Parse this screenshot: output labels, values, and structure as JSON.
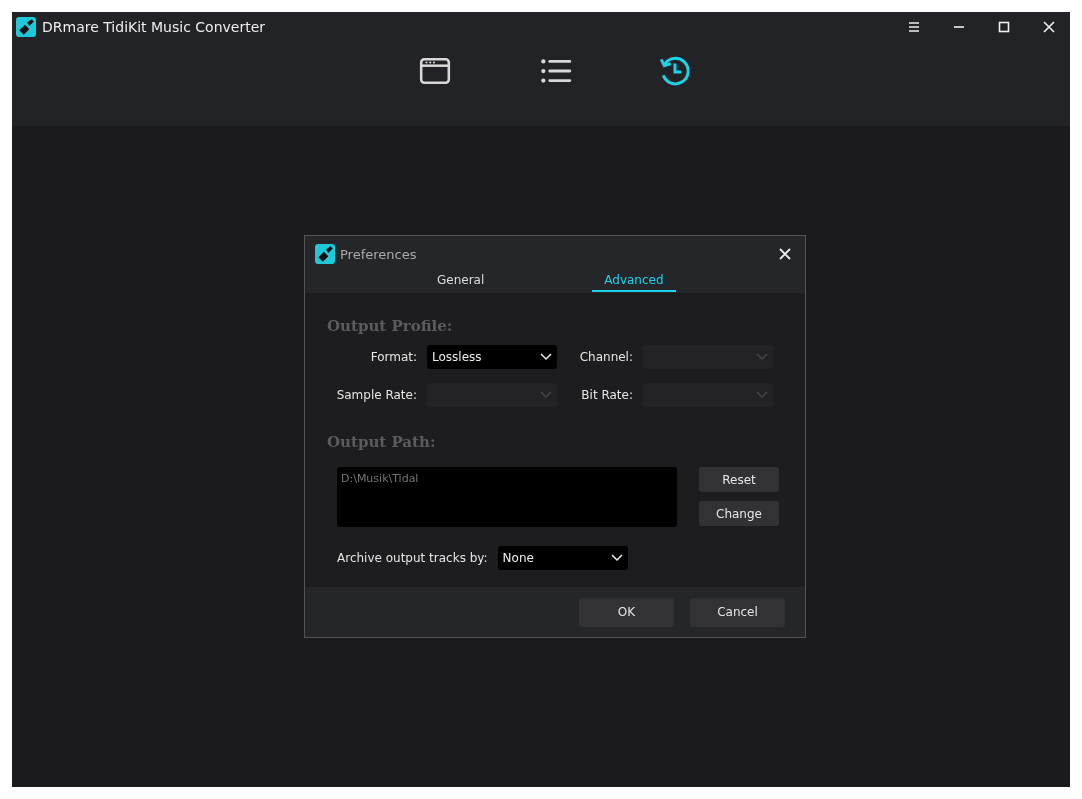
{
  "window": {
    "title": "DRmare TidiKit Music Converter"
  },
  "toolbar": [
    {
      "kind": "browser",
      "selected": false
    },
    {
      "kind": "list",
      "selected": false
    },
    {
      "kind": "history",
      "selected": true
    }
  ],
  "dialog": {
    "title": "Preferences",
    "tabs": [
      {
        "label": "General",
        "selected": false
      },
      {
        "label": "Advanced",
        "selected": true
      }
    ],
    "output_profile": {
      "heading": "Output Profile:",
      "fields": [
        {
          "label": "Format:",
          "value": "Lossless",
          "disabled": false
        },
        {
          "label": "Channel:",
          "disabled": true
        },
        {
          "label": "Sample Rate:",
          "disabled": true
        },
        {
          "label": "Bit Rate:",
          "disabled": true
        }
      ]
    },
    "output_path": {
      "heading": "Output Path:",
      "value": "D:\\Musik\\Tidal",
      "buttons": [
        "Reset",
        "Change"
      ]
    },
    "archive": {
      "label": "Archive output tracks by:",
      "value": "None"
    },
    "buttons": [
      "OK",
      "Cancel"
    ]
  }
}
